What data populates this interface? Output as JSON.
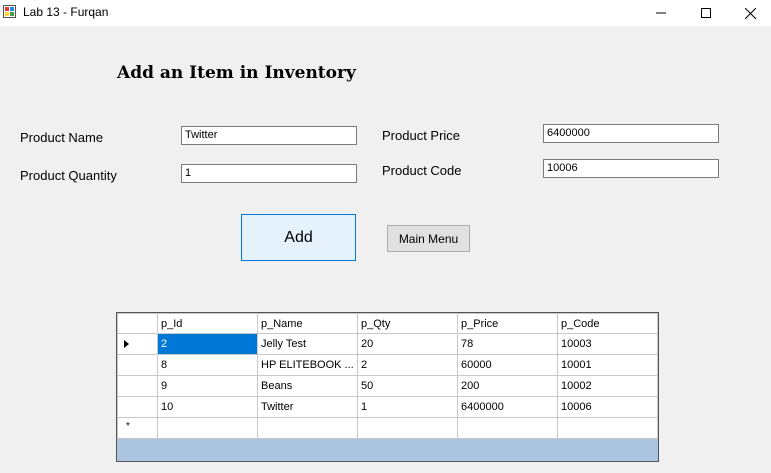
{
  "window": {
    "title": "Lab 13 - Furqan",
    "minimize": "—",
    "maximize": "☐",
    "close": "✕"
  },
  "form": {
    "heading": "Add an Item in Inventory",
    "labels": {
      "product_name": "Product Name",
      "product_quantity": "Product Quantity",
      "product_price": "Product Price",
      "product_code": "Product Code"
    },
    "values": {
      "product_name": "Twitter",
      "product_quantity": "1",
      "product_price": "6400000",
      "product_code": "10006"
    },
    "buttons": {
      "add": "Add",
      "main_menu": "Main Menu"
    }
  },
  "grid": {
    "columns": [
      "p_Id",
      "p_Name",
      "p_Qty",
      "p_Price",
      "p_Code"
    ],
    "rows": [
      [
        "2",
        "Jelly Test",
        "20",
        "78",
        "10003"
      ],
      [
        "8",
        "HP ELITEBOOK ...",
        "2",
        "60000",
        "10001"
      ],
      [
        "9",
        "Beans",
        "50",
        "200",
        "10002"
      ],
      [
        "10",
        "Twitter",
        "1",
        "6400000",
        "10006"
      ]
    ],
    "new_row_marker": "*"
  }
}
